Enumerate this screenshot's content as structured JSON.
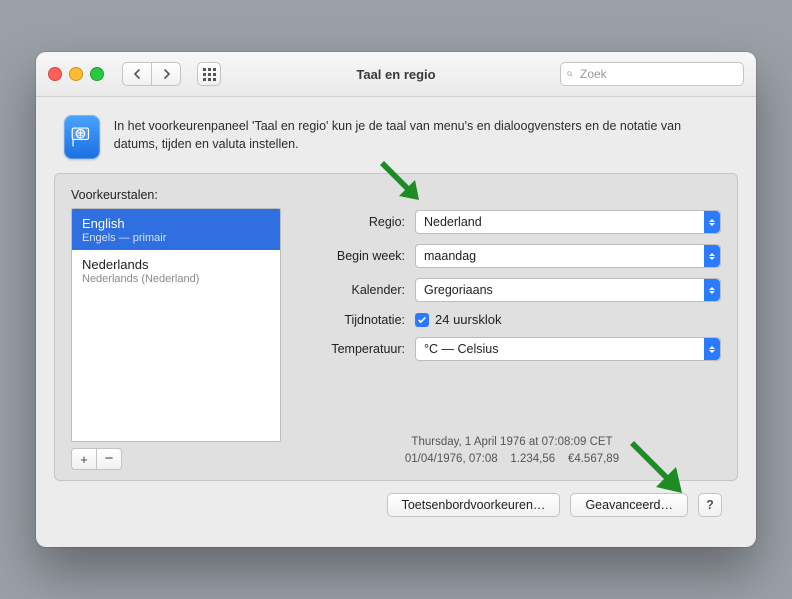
{
  "window": {
    "title": "Taal en regio"
  },
  "toolbar": {
    "search_placeholder": "Zoek"
  },
  "intro": {
    "text": "In het voorkeurenpaneel 'Taal en regio' kun je de taal van menu's en dialoogvensters en de notatie van datums, tijden en valuta instellen."
  },
  "languages": {
    "label": "Voorkeurstalen:",
    "items": [
      {
        "name": "English",
        "sub": "Engels — primair",
        "selected": true
      },
      {
        "name": "Nederlands",
        "sub": "Nederlands (Nederland)",
        "selected": false
      }
    ]
  },
  "settings": {
    "region": {
      "label": "Regio:",
      "value": "Nederland"
    },
    "first_day": {
      "label": "Begin week:",
      "value": "maandag"
    },
    "calendar": {
      "label": "Kalender:",
      "value": "Gregoriaans"
    },
    "time_format": {
      "label": "Tijdnotatie:",
      "value": "24 uursklok"
    },
    "temperature": {
      "label": "Temperatuur:",
      "value": "°C — Celsius"
    }
  },
  "sample": {
    "line1": "Thursday, 1 April 1976 at 07:08:09 CET",
    "line2": "01/04/1976, 07:08    1.234,56    €4.567,89"
  },
  "footer": {
    "keyboard": "Toetsenbordvoorkeuren…",
    "advanced": "Geavanceerd…",
    "help": "?"
  }
}
